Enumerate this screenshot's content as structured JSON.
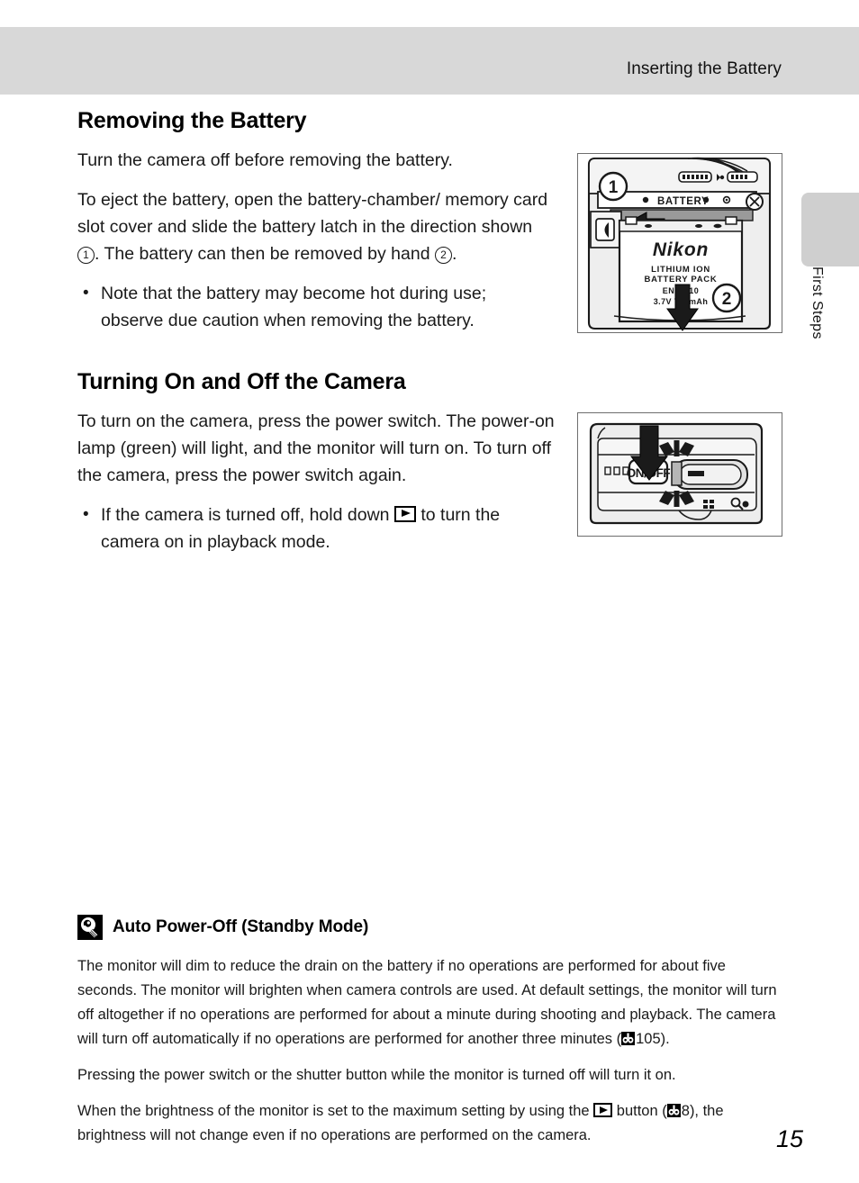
{
  "header": {
    "running_title": "Inserting the Battery"
  },
  "edge_tab": {
    "label": "First Steps"
  },
  "sections": [
    {
      "title": "Removing the Battery",
      "paragraphs": [
        "Turn the camera off before removing the battery."
      ],
      "para_with_circles_pre": "To eject the battery, open the battery-chamber/ memory card slot cover and slide the battery latch in the direction shown ",
      "circle_one": "1",
      "para_with_circles_mid": ". The battery can then be removed by hand ",
      "circle_two": "2",
      "para_with_circles_post": ".",
      "bullets": [
        "Note that the battery may become hot during use; observe due caution when removing the battery."
      ]
    },
    {
      "title": "Turning On and Off the Camera",
      "paragraphs": [
        "To turn on the camera, press the power switch. The power-on lamp (green) will light, and the monitor will turn on. To turn off the camera, press the power switch again."
      ],
      "bullet_pre": "If the camera is turned off, hold down ",
      "bullet_icon": "playback-button-icon",
      "bullet_post": " to turn the camera on in playback mode."
    }
  ],
  "illustrations": {
    "battery": {
      "name": "battery-removal-diagram",
      "callout_1": "1",
      "callout_2": "2",
      "chamber_label": "BATTERY",
      "battery_brand": "Nikon",
      "battery_line1": "LITHIUM ION",
      "battery_line2": "BATTERY PACK",
      "battery_model": "EN-EL10",
      "battery_rating": "3.7V 740mAh"
    },
    "power": {
      "name": "power-switch-diagram",
      "switch_label": "ON/OFF"
    }
  },
  "note": {
    "icon": "lightbulb-tip-icon",
    "title": "Auto Power-Off (Standby Mode)",
    "paragraph_1_pre": "The monitor will dim to reduce the drain on the battery if no operations are performed for about five seconds. The monitor will brighten when camera controls are used. At default settings, the monitor will turn off altogether if no operations are performed for about a minute during shooting and playback. The camera will turn off automatically if no operations are performed for another three minutes (",
    "paragraph_1_ref_page": "105",
    "paragraph_1_post": ").",
    "paragraph_2": "Pressing the power switch or the shutter button while the monitor is turned off will turn it on.",
    "paragraph_3_pre": "When the brightness of the monitor is set to the maximum setting by using the ",
    "paragraph_3_mid": " button (",
    "paragraph_3_ref_page": "8",
    "paragraph_3_post": "), the brightness will not change even if no operations are performed on the camera."
  },
  "folio": {
    "page_number": "15"
  },
  "colors": {
    "header_band": "#d8d8d8",
    "edge_tab": "#cfcfcf",
    "text": "#1a1a1a",
    "illustration_fill": "#e9e9e9"
  }
}
